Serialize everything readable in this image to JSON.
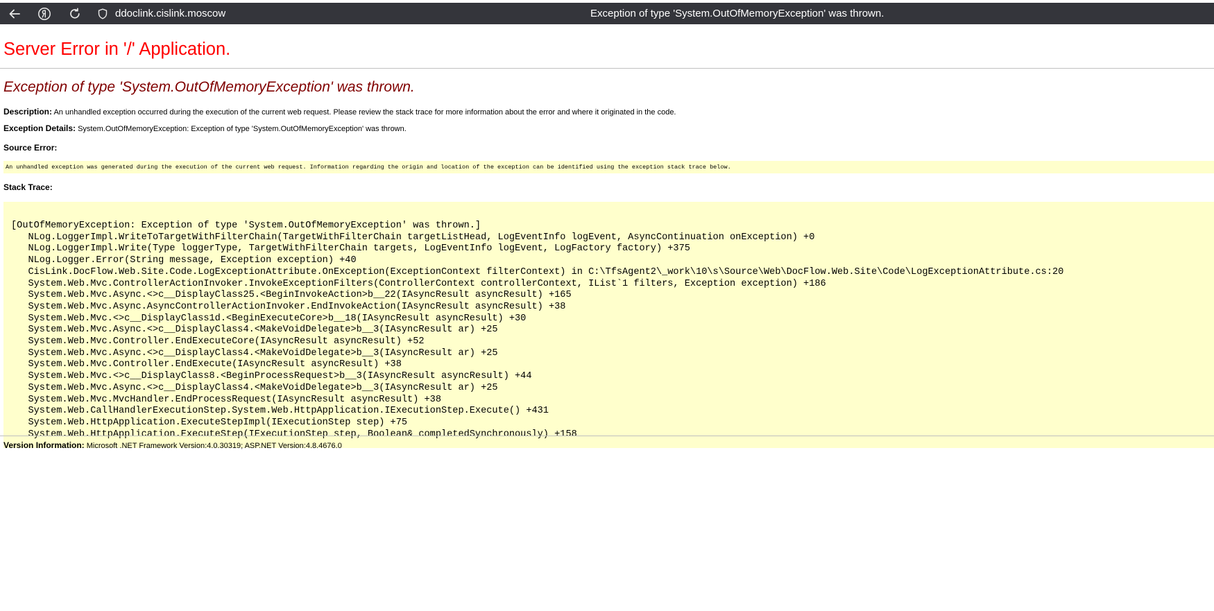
{
  "browser": {
    "url": "ddoclink.cislink.moscow",
    "tab_title": "Exception of type 'System.OutOfMemoryException' was thrown.",
    "icons": [
      "back-arrow-icon",
      "yandex-icon",
      "reload-icon",
      "shield-icon"
    ]
  },
  "page": {
    "heading": "Server Error in '/' Application.",
    "exception_heading": "Exception of type 'System.OutOfMemoryException' was thrown.",
    "description_label": "Description:",
    "description_text": "An unhandled exception occurred during the execution of the current web request. Please review the stack trace for more information about the error and where it originated in the code.",
    "exception_details_label": "Exception Details:",
    "exception_details_text": "System.OutOfMemoryException: Exception of type 'System.OutOfMemoryException' was thrown.",
    "source_error_label": "Source Error:",
    "source_error_text": "An unhandled exception was generated during the execution of the current web request. Information regarding the origin and location of the exception can be identified using the exception stack trace below.",
    "stack_trace_label": "Stack Trace:",
    "stack_trace_lines": [
      "[OutOfMemoryException: Exception of type 'System.OutOfMemoryException' was thrown.]",
      "   NLog.LoggerImpl.WriteToTargetWithFilterChain(TargetWithFilterChain targetListHead, LogEventInfo logEvent, AsyncContinuation onException) +0",
      "   NLog.LoggerImpl.Write(Type loggerType, TargetWithFilterChain targets, LogEventInfo logEvent, LogFactory factory) +375",
      "   NLog.Logger.Error(String message, Exception exception) +40",
      "   CisLink.DocFlow.Web.Site.Code.LogExceptionAttribute.OnException(ExceptionContext filterContext) in C:\\TfsAgent2\\_work\\10\\s\\Source\\Web\\DocFlow.Web.Site\\Code\\LogExceptionAttribute.cs:20",
      "   System.Web.Mvc.ControllerActionInvoker.InvokeExceptionFilters(ControllerContext controllerContext, IList`1 filters, Exception exception) +186",
      "   System.Web.Mvc.Async.<>c__DisplayClass25.<BeginInvokeAction>b__22(IAsyncResult asyncResult) +165",
      "   System.Web.Mvc.Async.AsyncControllerActionInvoker.EndInvokeAction(IAsyncResult asyncResult) +38",
      "   System.Web.Mvc.<>c__DisplayClass1d.<BeginExecuteCore>b__18(IAsyncResult asyncResult) +30",
      "   System.Web.Mvc.Async.<>c__DisplayClass4.<MakeVoidDelegate>b__3(IAsyncResult ar) +25",
      "   System.Web.Mvc.Controller.EndExecuteCore(IAsyncResult asyncResult) +52",
      "   System.Web.Mvc.Async.<>c__DisplayClass4.<MakeVoidDelegate>b__3(IAsyncResult ar) +25",
      "   System.Web.Mvc.Controller.EndExecute(IAsyncResult asyncResult) +38",
      "   System.Web.Mvc.<>c__DisplayClass8.<BeginProcessRequest>b__3(IAsyncResult asyncResult) +44",
      "   System.Web.Mvc.Async.<>c__DisplayClass4.<MakeVoidDelegate>b__3(IAsyncResult ar) +25",
      "   System.Web.Mvc.MvcHandler.EndProcessRequest(IAsyncResult asyncResult) +38",
      "   System.Web.CallHandlerExecutionStep.System.Web.HttpApplication.IExecutionStep.Execute() +431",
      "   System.Web.HttpApplication.ExecuteStepImpl(IExecutionStep step) +75",
      "   System.Web.HttpApplication.ExecuteStep(IExecutionStep step, Boolean& completedSynchronously) +158"
    ],
    "version_label": "Version Information:",
    "version_text": "Microsoft .NET Framework Version:4.0.30319; ASP.NET Version:4.8.4676.0"
  }
}
